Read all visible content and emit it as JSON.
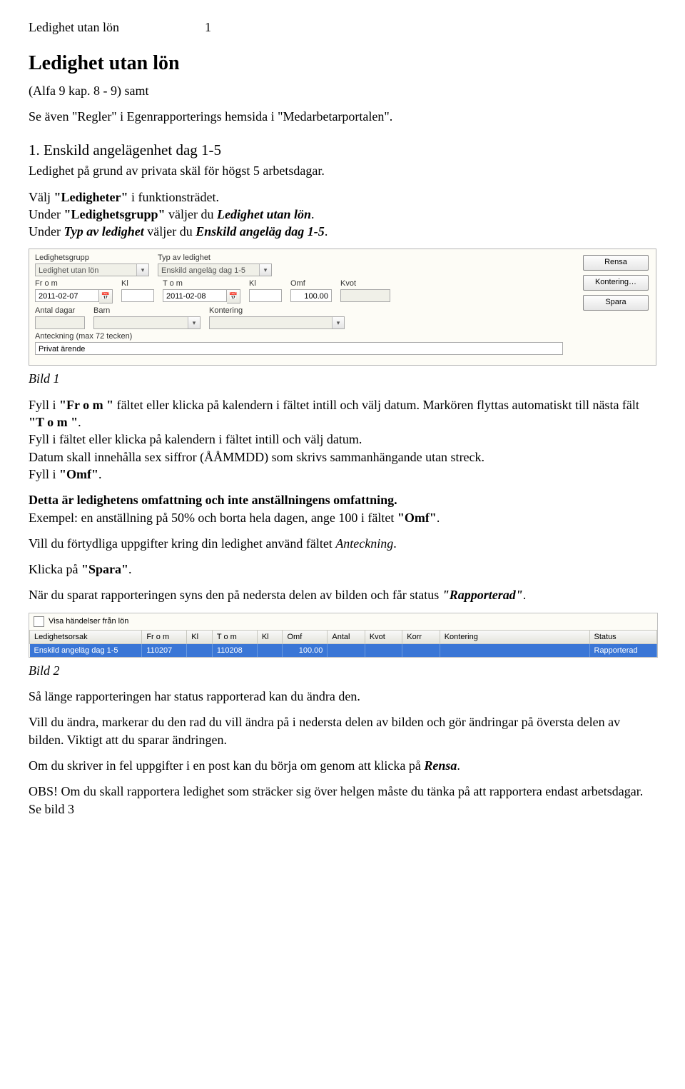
{
  "header": {
    "doc_title": "Ledighet utan lön",
    "page_no": "1"
  },
  "title": "Ledighet utan lön",
  "intro": {
    "line1_a": "(Alfa 9 kap. 8 - 9) samt",
    "line2_a": "Se även ",
    "line2_q1": "\"Regler\"",
    "line2_b": " i Egenrapporterings hemsida i ",
    "line2_q2": "\"Medarbetarportalen\"",
    "line2_c": "."
  },
  "sec1": {
    "heading": "1. Enskild angelägenhet dag 1-5",
    "sub": "Ledighet på grund av privata skäl för högst 5 arbetsdagar.",
    "p_a": "Välj ",
    "q1": "\"Ledigheter\"",
    "p_b": " i funktionsträdet.",
    "p_c": "Under ",
    "q2": "\"Ledighetsgrupp\"",
    "p_d": " väljer du ",
    "qi1": "Ledighet utan lön",
    "p_e": ".",
    "p_f": "Under ",
    "q3": "Typ av ledighet",
    "p_g": " väljer du ",
    "qi2": " Enskild angeläg dag 1-5",
    "p_h": "."
  },
  "form": {
    "labels": {
      "grp": "Ledighetsgrupp",
      "typ": "Typ av ledighet",
      "from": "Fr o m",
      "kl1": "Kl",
      "tom": "T o m",
      "kl2": "Kl",
      "omf": "Omf",
      "kvot": "Kvot",
      "antal": "Antal dagar",
      "barn": "Barn",
      "kont": "Kontering",
      "note": "Anteckning (max 72 tecken)"
    },
    "values": {
      "grp": "Ledighet utan lön",
      "typ": "Enskild angeläg dag 1-5",
      "from": "2011-02-07",
      "tom": "2011-02-08",
      "omf": "100.00",
      "note": "Privat ärende"
    },
    "buttons": {
      "rensa": "Rensa",
      "kont": "Kontering…",
      "spara": "Spara"
    }
  },
  "bild1": "Bild 1",
  "mid": {
    "p1_a": "Fyll i ",
    "p1_q1": "\"Fr o m \"",
    "p1_b": " fältet eller klicka på kalendern i fältet intill och välj datum. Markören flyttas automatiskt till nästa fält ",
    "p1_q2": "\"T o m \"",
    "p1_c": ".",
    "p2": "Fyll i fältet eller klicka på kalendern i fältet intill och välj datum.",
    "p3": " Datum skall innehålla sex siffror (ÅÅMMDD) som skrivs sammanhängande utan streck.",
    "p4_a": "Fyll i ",
    "p4_q": "\"Omf\"",
    "p4_b": ".",
    "p5": "Detta är ledighetens omfattning och inte anställningens omfattning.",
    "p6_a": "Exempel: en anställning på 50% och borta hela dagen, ange 100 i fältet ",
    "p6_q": "\"Omf\"",
    "p6_b": ".",
    "p7_a": "Vill du förtydliga uppgifter kring din ledighet använd fältet ",
    "p7_q": "Anteckning",
    "p7_b": ".",
    "p8_a": "Klicka på ",
    "p8_q": "\"Spara\"",
    "p8_b": ".",
    "p9_a": "När du sparat rapporteringen syns den på nedersta delen av bilden och får status ",
    "p9_q": "\"Rapporterad\"",
    "p9_b": "."
  },
  "table": {
    "vis_label": "Visa händelser från lön",
    "headers": [
      "Ledighetsorsak",
      "Fr o m",
      "Kl",
      "T o m",
      "Kl",
      "Omf",
      "Antal",
      "Kvot",
      "Korr",
      "Kontering",
      "Status"
    ],
    "row": [
      "Enskild angeläg dag 1-5",
      "110207",
      "",
      "110208",
      "",
      "100.00",
      "",
      "",
      "",
      "",
      "Rapporterad"
    ]
  },
  "bild2": "Bild 2",
  "tail": {
    "p1": "Så länge rapporteringen har status rapporterad kan du ändra den.",
    "p2": "Vill du ändra, markerar du den rad du vill ändra på i nedersta delen av bilden och gör ändringar på översta delen av bilden. Viktigt att du sparar ändringen.",
    "p3_a": "Om du skriver in fel uppgifter i en post kan du börja om genom att klicka på ",
    "p3_q": "Rensa",
    "p3_b": ".",
    "p4_a": "OBS!",
    "p4_b": " Om du skall rapportera ledighet som sträcker sig över helgen måste du tänka på att rapportera endast arbetsdagar. Se bild 3"
  }
}
